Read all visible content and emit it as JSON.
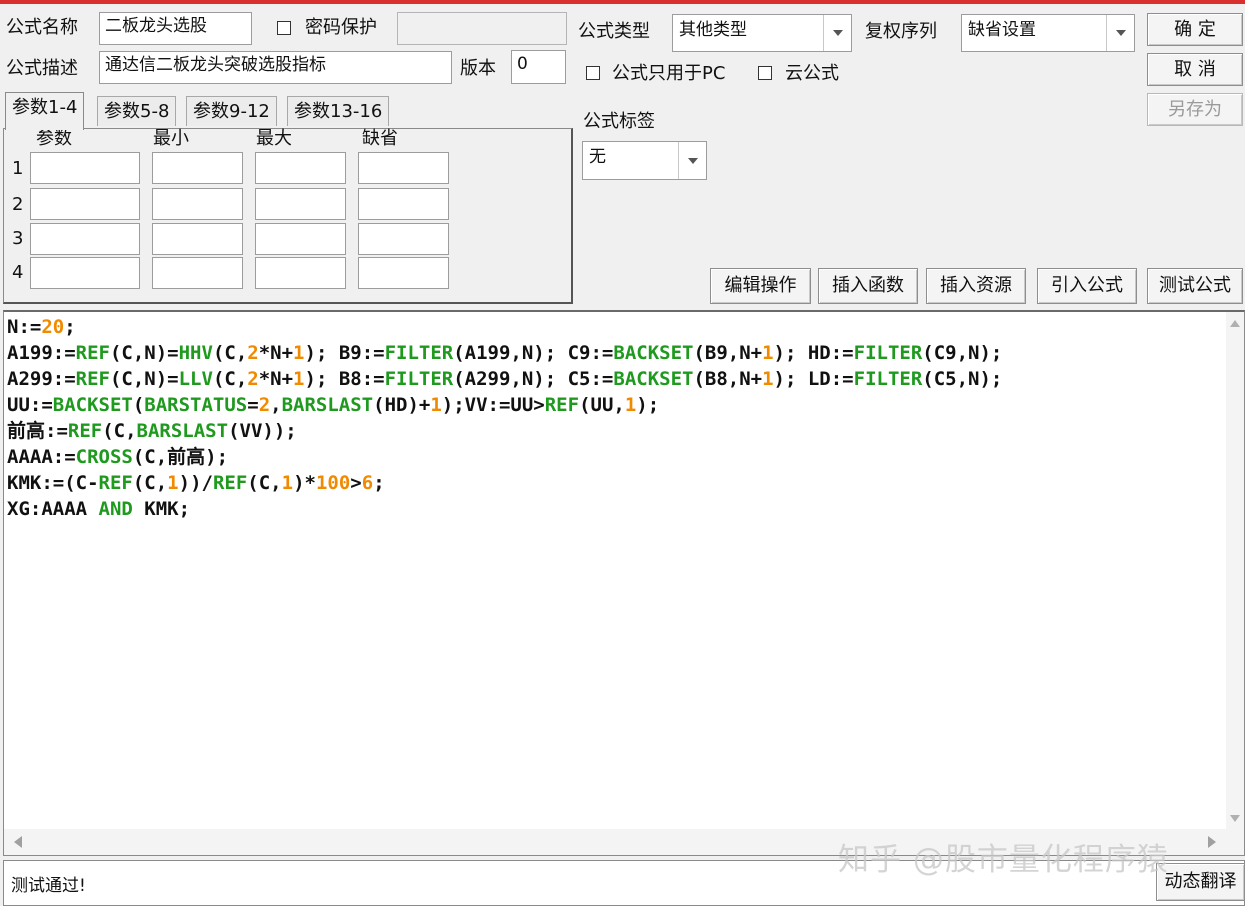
{
  "header": {
    "name_label": "公式名称",
    "name_value": "二板龙头选股",
    "password_label": "密码保护",
    "password_value": "",
    "desc_label": "公式描述",
    "desc_value": "通达信二板龙头突破选股指标",
    "version_label": "版本",
    "version_value": "0",
    "type_label": "公式类型",
    "type_value": "其他类型",
    "fuquan_label": "复权序列",
    "fuquan_value": "缺省设置",
    "pc_only_label": "公式只用于PC",
    "cloud_label": "云公式",
    "tag_label": "公式标签",
    "tag_value": "无"
  },
  "buttons": {
    "confirm": "确  定",
    "cancel": "取  消",
    "save_as": "另存为",
    "edit_ops": "编辑操作",
    "insert_func": "插入函数",
    "insert_res": "插入资源",
    "import_formula": "引入公式",
    "test_formula": "测试公式",
    "dynamic_translate": "动态翻译"
  },
  "tabs": [
    "参数1-4",
    "参数5-8",
    "参数9-12",
    "参数13-16"
  ],
  "params": {
    "columns": [
      "参数",
      "最小",
      "最大",
      "缺省"
    ],
    "rows": [
      "1",
      "2",
      "3",
      "4"
    ]
  },
  "code_lines": [
    "N:=20;",
    "A199:=REF(C,N)=HHV(C,2*N+1); B9:=FILTER(A199,N); C9:=BACKSET(B9,N+1); HD:=FILTER(C9,N);",
    "A299:=REF(C,N)=LLV(C,2*N+1); B8:=FILTER(A299,N); C5:=BACKSET(B8,N+1); LD:=FILTER(C5,N);",
    "UU:=BACKSET(BARSTATUS=2,BARSLAST(HD)+1);VV:=UU>REF(UU,1);",
    "前高:=REF(C,BARSLAST(VV));",
    "AAAA:=CROSS(C,前高);",
    "KMK:=(C-REF(C,1))/REF(C,1)*100>6;",
    "XG:AAAA AND KMK;"
  ],
  "status_text": "测试通过!",
  "watermark": "知乎 @股市量化程序猿",
  "colors": {
    "keyword": "#1f9a1f",
    "number": "#f08a00",
    "accent_bar": "#d9302f"
  }
}
